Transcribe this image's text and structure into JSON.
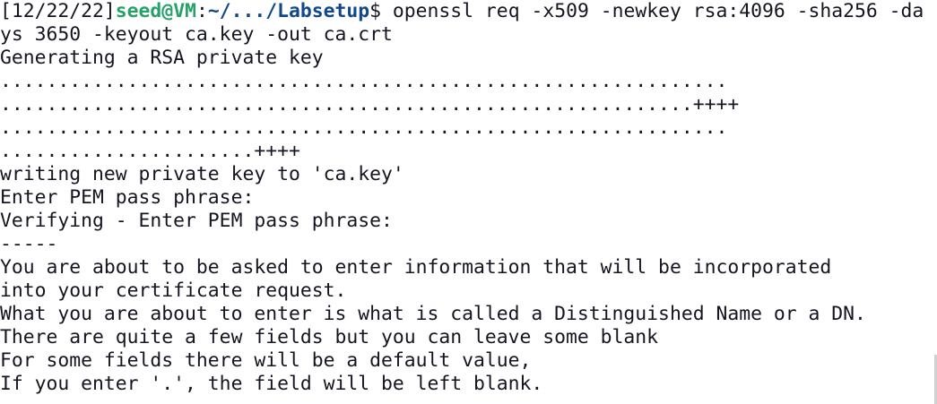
{
  "prompt": {
    "date": "[12/22/22]",
    "user_host": "seed@VM",
    "colon": ":",
    "path": "~/.../Labsetup",
    "dollar": "$ "
  },
  "command": {
    "line1": "openssl req -x509 -newkey rsa:4096 -sha256 -da",
    "line2": "ys 3650 -keyout ca.key -out ca.crt"
  },
  "output": [
    "Generating a RSA private key",
    "...............................................................",
    "............................................................++++",
    "...............................................................",
    "......................++++",
    "writing new private key to 'ca.key'",
    "Enter PEM pass phrase:",
    "Verifying - Enter PEM pass phrase:",
    "-----",
    "You are about to be asked to enter information that will be incorporated",
    "into your certificate request.",
    "What you are about to enter is what is called a Distinguished Name or a DN.",
    "There are quite a few fields but you can leave some blank",
    "For some fields there will be a default value,",
    "If you enter '.', the field will be left blank."
  ],
  "colors": {
    "background": "#ffffff",
    "text": "#171421",
    "user_host": "#26a269",
    "path": "#12488b"
  }
}
